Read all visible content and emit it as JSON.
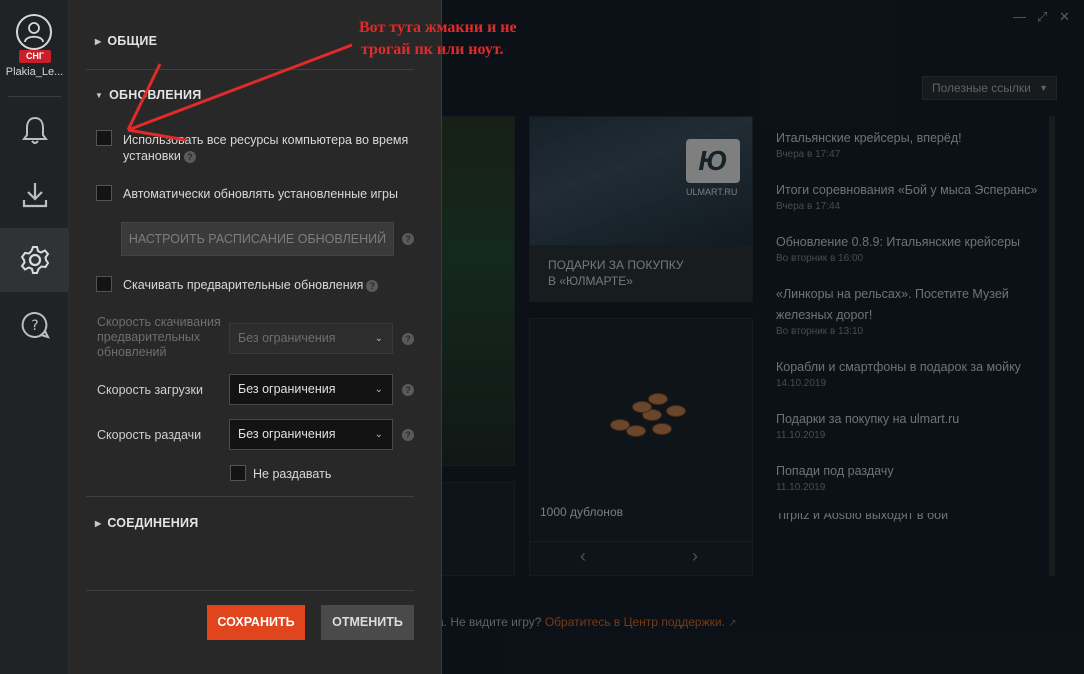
{
  "rail": {
    "username": "Plakia_Le...",
    "region": "СНГ",
    "items": [
      {
        "icon": "bell-icon",
        "active": false
      },
      {
        "icon": "download-icon",
        "active": false
      },
      {
        "icon": "gear-icon",
        "active": true
      },
      {
        "icon": "help-chat-icon",
        "active": false
      }
    ]
  },
  "background": {
    "useful_links": "Полезные ссылки",
    "promo_ulmart": "ПОДАРКИ ЗА ПОКУПКУ\nВ «ЮЛМАРТЕ»",
    "ulmart_logo_text": "ULMART.RU",
    "doubloons": "1000 дублонов",
    "news": [
      {
        "title": "Итальянские крейсеры, вперёд!",
        "date": "Вчера в 17:47"
      },
      {
        "title": "Итоги соревнования «Бой у мыса Эсперанс»",
        "date": "Вчера в 17:44"
      },
      {
        "title": "Обновление 0.8.9: Итальянские крейсеры",
        "date": "Во вторник в 16:00"
      },
      {
        "title": "«Линкоры на рельсах». Посетите Музей железных дорог!",
        "date": "Во вторник в 13:10"
      },
      {
        "title": "Корабли и смартфоны в подарок за мойку",
        "date": "14.10.2019"
      },
      {
        "title": "Подарки за покупку на ulmart.ru",
        "date": "11.10.2019"
      },
      {
        "title": "Попади под раздачу",
        "date": "11.10.2019"
      },
      {
        "title": "Tirpitz и Aosbio выходят в бой",
        "date": ""
      }
    ],
    "support_text": "а. Не видите игру?",
    "support_link": "Обратитесь в Центр поддержки."
  },
  "settings": {
    "general": "ОБЩИЕ",
    "updates": "ОБНОВЛЕНИЯ",
    "use_all_resources": "Использовать все ресурсы компьютера во время установки",
    "auto_update": "Автоматически обновлять установленные игры",
    "schedule_button": "НАСТРОИТЬ РАСПИСАНИЕ ОБНОВЛЕНИЙ",
    "predownload": "Скачивать предварительные обновления",
    "predownload_speed_label": "Скорость скачивания предварительных обновлений",
    "predownload_speed_value": "Без ограничения",
    "download_speed_label": "Скорость загрузки",
    "download_speed_value": "Без ограничения",
    "upload_speed_label": "Скорость раздачи",
    "upload_speed_value": "Без ограничения",
    "no_seed": "Не раздавать",
    "connections": "СОЕДИНЕНИЯ",
    "save": "СОХРАНИТЬ",
    "cancel": "ОТМЕНИТЬ",
    "help": "?"
  },
  "annotation": {
    "line1": "Вот тута жмакни и не",
    "line2": "трогай пк или ноут.",
    "color": "#e12a2a"
  },
  "colors": {
    "accent": "#e0451d",
    "region_badge": "#c8202a"
  }
}
